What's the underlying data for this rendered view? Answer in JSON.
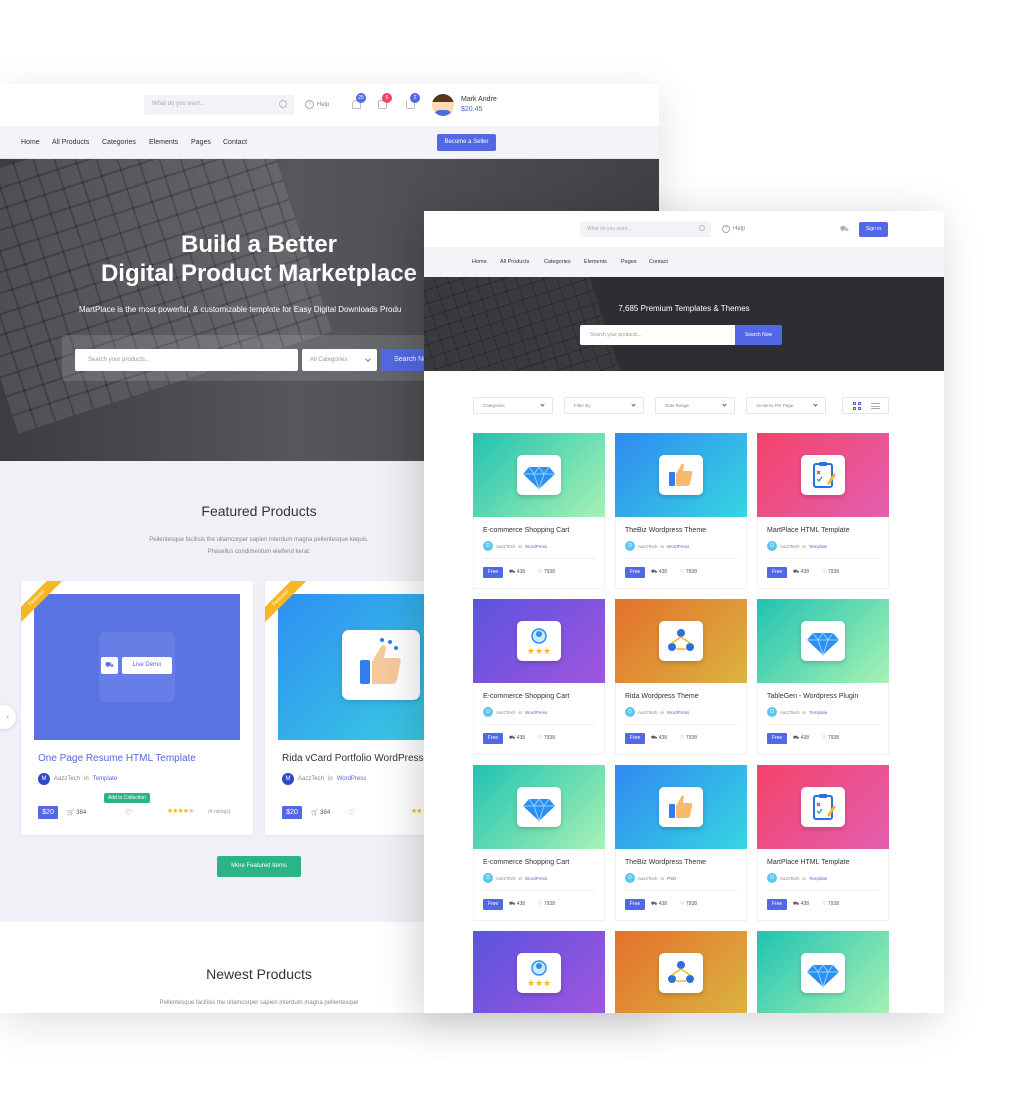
{
  "back": {
    "header": {
      "search_placeholder": "What do you want...",
      "help_label": "Help",
      "badges": [
        "25",
        "6",
        "2"
      ],
      "user_name": "Mark Andre",
      "user_balance": "$20.45"
    },
    "nav": [
      "Home",
      "All Products",
      "Categories",
      "Elements",
      "Pages",
      "Contact"
    ],
    "become_seller": "Become a Seller",
    "hero": {
      "title_line1": "Build a Better",
      "title_line2": "Digital Product Marketplace",
      "subtitle": "MartPlace is the most powerful, & customizable template for Easy Digital Downloads Produ",
      "search_placeholder": "Search your products...",
      "category_select": "All Categories",
      "search_button": "Search No"
    },
    "featured": {
      "title": "Featured Products",
      "subtitle": "Pellentesque facilisis the ullamcorper sapien interdum magna pellentesque kequis. Phasellus condimentum eleifend kerat.",
      "ribbon": "Featured",
      "cards": [
        {
          "title": "One Page Resume HTML Template",
          "author_initial": "M",
          "author": "AazzTech",
          "in": "in",
          "category": "Template",
          "price": "$20",
          "sales": "384",
          "ratings": "(4 ratings)",
          "live_demo": "Live Demo",
          "tooltip": "Add to Collection"
        },
        {
          "title": "Rida vCard Portfolio WordPress",
          "author_initial": "M",
          "author": "AazzTech",
          "in": "in",
          "category": "WordPress",
          "price": "$20",
          "sales": "384"
        }
      ],
      "more_button": "More Featured Items"
    },
    "newest": {
      "title": "Newest Products",
      "subtitle": "Pellentesque facilisis the ullamcorper sapien interdum magna pellentesque"
    }
  },
  "front": {
    "header": {
      "search_placeholder": "What do you want...",
      "help_label": "Help",
      "signin": "Sign in"
    },
    "nav": [
      "Home",
      "All Products",
      "Categories",
      "Elements",
      "Pages",
      "Contact"
    ],
    "hero": {
      "title": "7,685 Premium Templates & Themes",
      "search_placeholder": "Search your products...",
      "search_button": "Search Now"
    },
    "filters": [
      "Categories",
      "Filter By",
      "Date Range",
      "15 Items Per Page"
    ],
    "products": [
      {
        "title": "E-commerce Shopping Cart",
        "author": "AazzTech",
        "in": "in",
        "category": "WordPress",
        "price": "Free",
        "sales": "438",
        "likes": "7938",
        "theme": "teal",
        "icon": "diamond-icon"
      },
      {
        "title": "TheBiz Wordpress Theme",
        "author": "AazzTech",
        "in": "in",
        "category": "WordPress",
        "price": "Free",
        "sales": "438",
        "likes": "7938",
        "theme": "blue",
        "icon": "thumbs-up-icon"
      },
      {
        "title": "MartPlace HTML Template",
        "author": "AazzTech",
        "in": "in",
        "category": "Template",
        "price": "Free",
        "sales": "438",
        "likes": "7938",
        "theme": "pink",
        "icon": "clipboard-icon"
      },
      {
        "title": "E-commerce Shopping Cart",
        "author": "AazzTech",
        "in": "in",
        "category": "WordPress",
        "price": "Free",
        "sales": "438",
        "likes": "7938",
        "theme": "purple",
        "icon": "user-rating-icon"
      },
      {
        "title": "Rida Wordpress Theme",
        "author": "AazzTech",
        "in": "in",
        "category": "WordPress",
        "price": "Free",
        "sales": "438",
        "likes": "7938",
        "theme": "orange",
        "icon": "team-icon"
      },
      {
        "title": "TableGen - Wordpress Plugin",
        "author": "AazzTech",
        "in": "in",
        "category": "Template",
        "price": "Free",
        "sales": "438",
        "likes": "7938",
        "theme": "teal",
        "icon": "diamond-icon"
      },
      {
        "title": "E-commerce Shopping Cart",
        "author": "AazzTech",
        "in": "in",
        "category": "WordPress",
        "price": "Free",
        "sales": "438",
        "likes": "7938",
        "theme": "teal",
        "icon": "diamond-icon"
      },
      {
        "title": "TheBiz Wordpress Theme",
        "author": "AazzTech",
        "in": "in",
        "category": "PSD",
        "price": "Free",
        "sales": "438",
        "likes": "7938",
        "theme": "blue",
        "icon": "thumbs-up-icon"
      },
      {
        "title": "MartPlace HTML Template",
        "author": "AazzTech",
        "in": "in",
        "category": "Template",
        "price": "Free",
        "sales": "438",
        "likes": "7938",
        "theme": "pink",
        "icon": "clipboard-icon"
      },
      {
        "title": "",
        "theme": "purple",
        "icon": "user-rating-icon"
      },
      {
        "title": "",
        "theme": "orange",
        "icon": "team-icon"
      },
      {
        "title": "",
        "theme": "teal",
        "icon": "diamond-icon"
      }
    ]
  },
  "colors": {
    "primary": "#5368e5",
    "green": "#2bb586",
    "ribbon": "#f5b824",
    "dark": "#2c2e33"
  }
}
